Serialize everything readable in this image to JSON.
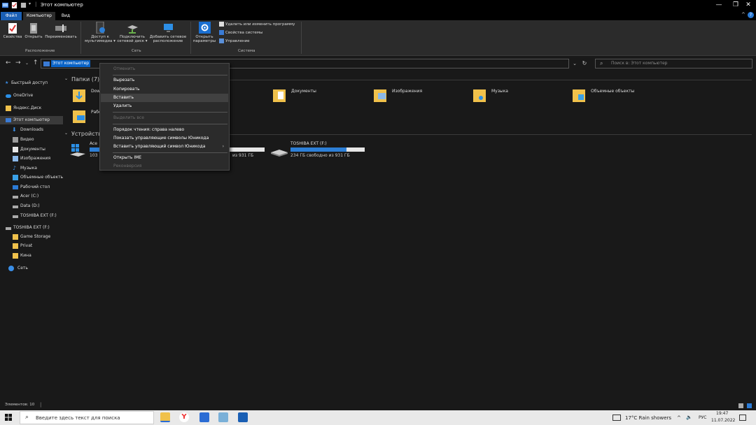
{
  "window": {
    "title": "Этот компьютер",
    "controls": {
      "minimize": "—",
      "maximize": "❐",
      "close": "✕"
    }
  },
  "ribbon": {
    "tabs": {
      "file": "Файл",
      "computer": "Компьютер",
      "view": "Вид"
    },
    "location_group": {
      "label": "Расположение",
      "properties": "Свойства",
      "open": "Открыть",
      "rename": "Переименовать"
    },
    "network_group": {
      "label": "Сеть",
      "media_access_1": "Доступ к",
      "media_access_2": "мультимедиа ▾",
      "map_drive_1": "Подключить",
      "map_drive_2": "сетевой диск ▾",
      "add_location_1": "Добавить сетевое",
      "add_location_2": "расположение"
    },
    "system_group": {
      "label": "Система",
      "open_settings_1": "Открыть",
      "open_settings_2": "параметры",
      "uninstall": "Удалить или изменить программу",
      "system_properties": "Свойства системы",
      "manage": "Управление"
    }
  },
  "address": {
    "path": "Этот компьютер",
    "dropdown": "⌄",
    "refresh": "↻",
    "search_placeholder": "Поиск в: Этот компьютер"
  },
  "nav": {
    "back": "←",
    "forward": "→",
    "recent": "⌄",
    "up": "↑"
  },
  "sidebar": {
    "items": [
      {
        "label": "Быстрый доступ"
      },
      {
        "label": "OneDrive"
      },
      {
        "label": "Яндекс.Диск"
      },
      {
        "label": "Этот компьютер"
      },
      {
        "label": "Downloads"
      },
      {
        "label": "Видео"
      },
      {
        "label": "Документы"
      },
      {
        "label": "Изображения"
      },
      {
        "label": "Музыка"
      },
      {
        "label": "Объемные объекты"
      },
      {
        "label": "Рабочий стол"
      },
      {
        "label": "Acer (C:)"
      },
      {
        "label": "Data (D:)"
      },
      {
        "label": "TOSHIBA EXT (F:)"
      },
      {
        "label": "TOSHIBA EXT (F:)"
      },
      {
        "label": "Game Storage"
      },
      {
        "label": "Privat"
      },
      {
        "label": "Кина"
      },
      {
        "label": "Сеть"
      }
    ]
  },
  "content": {
    "folders_header": "Папки (7)",
    "devices_header": "Устройства",
    "folders": [
      {
        "label": "Dow"
      },
      {
        "label": "Документы"
      },
      {
        "label": "Изображения"
      },
      {
        "label": "Музыка"
      },
      {
        "label": "Объемные объекты"
      },
      {
        "label": "Рабо"
      }
    ],
    "drives": [
      {
        "label": "Ace",
        "free": "103",
        "fill": 0.5
      },
      {
        "label": "",
        "free": "из 931 ГБ",
        "fill": 0.15
      },
      {
        "label": "TOSHIBA EXT (F:)",
        "free": "234 ГБ свободно из 931 ГБ",
        "fill": 0.75
      }
    ]
  },
  "context_menu": {
    "undo": "Отменить",
    "cut": "Вырезать",
    "copy": "Копировать",
    "paste": "Вставить",
    "delete": "Удалить",
    "select_all": "Выделить все",
    "rtl": "Порядок чтения: справа налево",
    "show_unicode": "Показать управляющие символы Юникода",
    "insert_unicode": "Вставить управляющий символ Юникода",
    "submenu_arrow": "›",
    "open_ime": "Открыть IME",
    "reconversion": "Реконверсия"
  },
  "statusbar": {
    "items": "Элементов: 10"
  },
  "taskbar": {
    "search_placeholder": "Введите здесь текст для поиска",
    "weather": "17°C  Rain showers",
    "tray_up": "^",
    "volume": "🔈",
    "lang": "РУС",
    "time": "19:47",
    "date": "11.07.2022"
  },
  "colors": {
    "accent": "#0a64c8",
    "folder": "#f0c14b",
    "bg": "#191919"
  }
}
